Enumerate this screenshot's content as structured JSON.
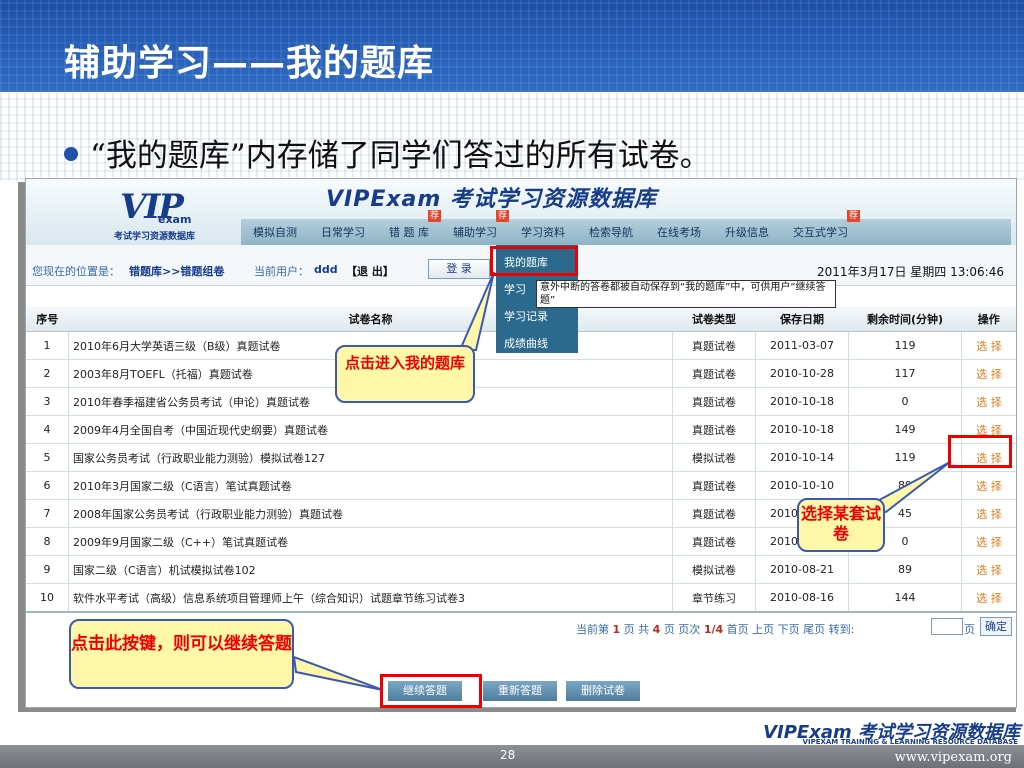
{
  "slide": {
    "title": "辅助学习——我的题库",
    "bullet": "“我的题库”内存储了同学们答过的所有试卷。",
    "page_number": "28",
    "footer_brand": "VIPExam 考试学习资源数据库",
    "footer_tagline": "VIPEXAM TRAINING & LEARNING RESOURCE DATABASE",
    "footer_url": "www.vipexam.org"
  },
  "app": {
    "logo_text": "VIP",
    "logo_exam": "exam",
    "logo_sub": "考试学习资源数据库",
    "title": "VIPExam 考试学习资源数据库",
    "nav": [
      {
        "label": "模拟自测",
        "tag": ""
      },
      {
        "label": "日常学习",
        "tag": ""
      },
      {
        "label": "错 题 库",
        "tag": "荐"
      },
      {
        "label": "辅助学习",
        "tag": "荐"
      },
      {
        "label": "学习资料",
        "tag": ""
      },
      {
        "label": "检索导航",
        "tag": ""
      },
      {
        "label": "在线考场",
        "tag": ""
      },
      {
        "label": "升级信息",
        "tag": ""
      },
      {
        "label": "交互式学习",
        "tag": "荐"
      }
    ],
    "breadcrumb_label": "您现在的位置是：",
    "breadcrumb_path": "错题库>>错题组卷",
    "user_label": "当前用户：",
    "user_name": "ddd",
    "logout": "【退 出】",
    "login": "登 录",
    "datetime": "2011年3月17日 星期四 13:06:46",
    "dropdown": [
      "我的题库",
      "学习",
      "学习记录",
      "成绩曲线"
    ],
    "tooltip": "意外中断的答卷都被自动保存到“我的题库”中，可供用户“继续答题”"
  },
  "table": {
    "headers": [
      "序号",
      "试卷名称",
      "试卷类型",
      "保存日期",
      "剩余时间(分钟)",
      "操作"
    ],
    "rows": [
      [
        "1",
        "2010年6月大学英语三级（B级）真题试卷",
        "真题试卷",
        "2011-03-07",
        "119",
        "选 择"
      ],
      [
        "2",
        "2003年8月TOEFL（托福）真题试卷",
        "真题试卷",
        "2010-10-28",
        "117",
        "选 择"
      ],
      [
        "3",
        "2010年春季福建省公务员考试（申论）真题试卷",
        "真题试卷",
        "2010-10-18",
        "0",
        "选 择"
      ],
      [
        "4",
        "2009年4月全国自考（中国近现代史纲要）真题试卷",
        "真题试卷",
        "2010-10-18",
        "149",
        "选 择"
      ],
      [
        "5",
        "国家公务员考试（行政职业能力测验）模拟试卷127",
        "模拟试卷",
        "2010-10-14",
        "119",
        "选 择"
      ],
      [
        "6",
        "2010年3月国家二级（C语言）笔试真题试卷",
        "真题试卷",
        "2010-10-10",
        "89",
        "选 择"
      ],
      [
        "7",
        "2008年国家公务员考试（行政职业能力测验）真题试卷",
        "真题试卷",
        "2010-09-14",
        "45",
        "选 择"
      ],
      [
        "8",
        "2009年9月国家二级（C++）笔试真题试卷",
        "真题试卷",
        "2010-08-25",
        "0",
        "选 择"
      ],
      [
        "9",
        "国家二级（C语言）机试模拟试卷102",
        "模拟试卷",
        "2010-08-21",
        "89",
        "选 择"
      ],
      [
        "10",
        "软件水平考试（高级）信息系统项目管理师上午（综合知识）试题章节练习试卷3",
        "章节练习",
        "2010-08-16",
        "144",
        "选 择"
      ]
    ]
  },
  "pager": {
    "prefix": "当前第",
    "current": "1",
    "mid1": "页 共",
    "total": "4",
    "mid2": "页  页次",
    "ratio": "1/4",
    "links": "首页  上页  下页  尾页",
    "goto": "转到:",
    "page_unit": "页",
    "confirm": "确定"
  },
  "actions": {
    "continue": "继续答题",
    "restart": "重新答题",
    "delete": "删除试卷"
  },
  "callouts": {
    "enter": "点击进入我的题库",
    "select": "选择某套试卷",
    "continue": "点击此按键，则可以继续答题"
  },
  "colors": {
    "accent": "#173d8a",
    "highlight_red": "#e00000",
    "callout_fill": "#fff7a8",
    "op_orange": "#e07b1c"
  }
}
